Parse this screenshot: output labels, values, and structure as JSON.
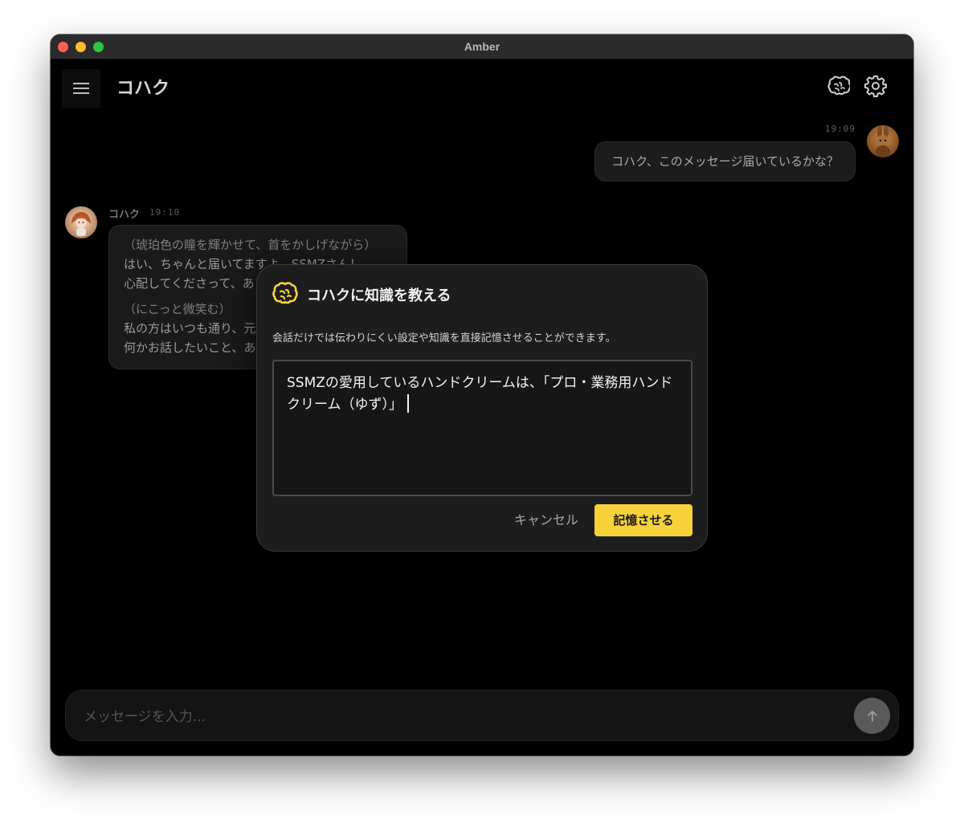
{
  "window": {
    "title": "Amber"
  },
  "header": {
    "title": "コハク",
    "menu_icon": "hamburger-menu-icon",
    "knowledge_icon": "brain-icon",
    "settings_icon": "gear-icon"
  },
  "messages": {
    "user": {
      "time": "19:09",
      "text": "コハク、このメッセージ届いているかな？"
    },
    "bot": {
      "name": "コハク",
      "time": "19:10",
      "lines": [
        "（琥珀色の瞳を輝かせて、首をかしげながら）",
        "はい、ちゃんと届いてますよ、SSMZさん！",
        "心配してくださって、あ",
        "（にこっと微笑む）",
        "私の方はいつも通り、元",
        "何かお話したいこと、あ"
      ]
    }
  },
  "composer": {
    "placeholder": "メッセージを入力..."
  },
  "modal": {
    "title": "コハクに知識を教える",
    "description": "会話だけでは伝わりにくい設定や知識を直接記憶させることができます。",
    "input_value": "SSMZの愛用しているハンドクリームは、「プロ・業務用ハンドクリーム（ゆず）」",
    "cancel_label": "キャンセル",
    "confirm_label": "記憶させる"
  },
  "colors": {
    "accent": "#f7d23b",
    "background": "#000000"
  }
}
